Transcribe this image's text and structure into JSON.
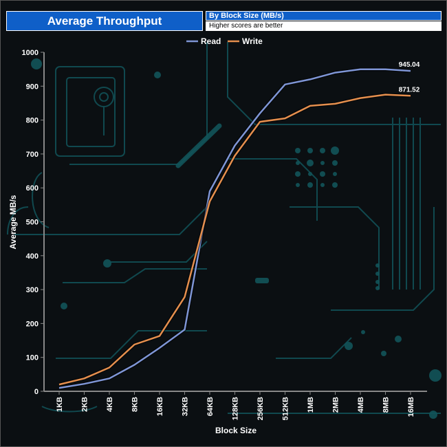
{
  "header": {
    "title": "Average Throughput",
    "subtitle": "By Block Size (MB/s)",
    "note": "Higher scores are better"
  },
  "colors": {
    "read": "#7f96d6",
    "write": "#e58f4e",
    "header_blue": "#0f5fc8",
    "circuit": "#12545a"
  },
  "chart_data": {
    "type": "line",
    "title": "Average Throughput",
    "subtitle": "By Block Size (MB/s)",
    "xlabel": "Block Size",
    "ylabel": "Average MB/s",
    "ylim": [
      0,
      1000
    ],
    "yticks": [
      0,
      100,
      200,
      300,
      400,
      500,
      600,
      700,
      800,
      900,
      1000
    ],
    "grid": false,
    "legend": "top-center",
    "categories": [
      "1KB",
      "2KB",
      "4KB",
      "8KB",
      "16KB",
      "32KB",
      "64KB",
      "128KB",
      "256KB",
      "512KB",
      "1MB",
      "2MB",
      "4MB",
      "8MB",
      "16MB"
    ],
    "series": [
      {
        "name": "Read",
        "color": "#7f96d6",
        "values": [
          10,
          22,
          38,
          78,
          128,
          182,
          590,
          725,
          820,
          905,
          920,
          940,
          950,
          950,
          945.04
        ],
        "end_label": "945.04"
      },
      {
        "name": "Write",
        "color": "#e58f4e",
        "values": [
          20,
          38,
          70,
          138,
          163,
          278,
          560,
          695,
          795,
          805,
          842,
          848,
          865,
          875,
          871.52
        ],
        "end_label": "871.52"
      }
    ]
  }
}
